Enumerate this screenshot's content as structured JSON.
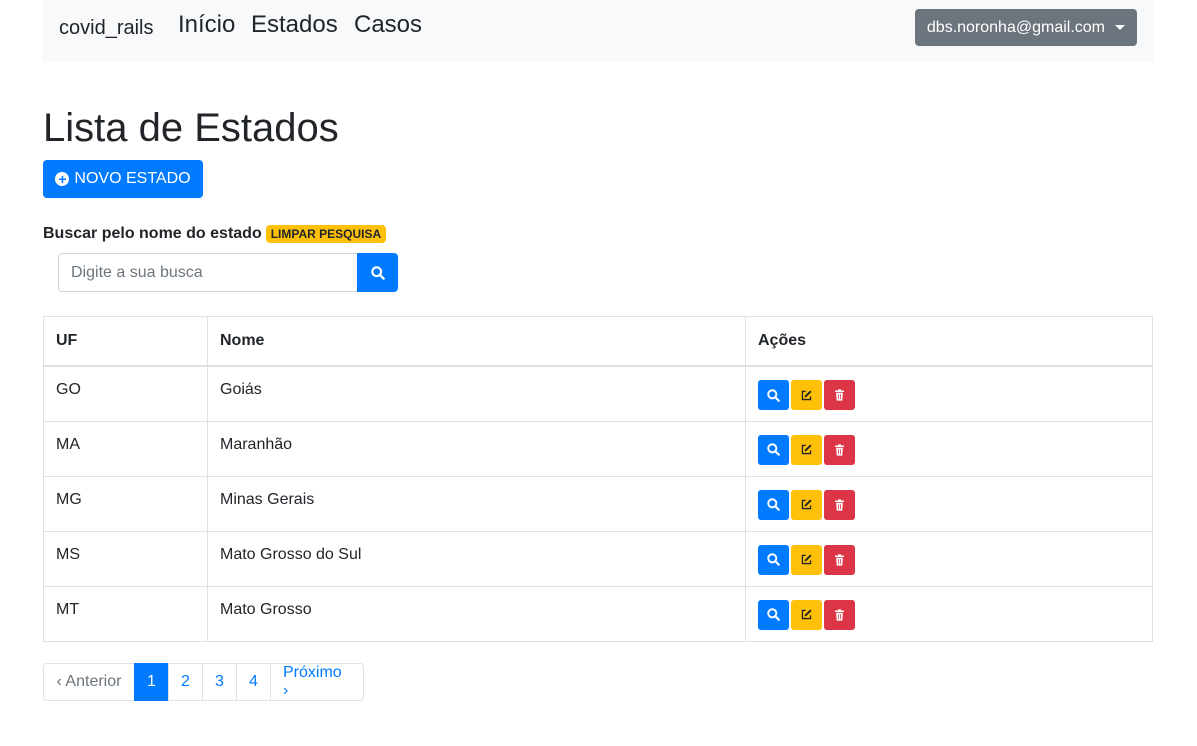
{
  "navbar": {
    "brand": "covid_rails",
    "links": [
      "Início",
      "Estados",
      "Casos"
    ],
    "user_email": "dbs.noronha@gmail.com"
  },
  "page_title": "Lista de Estados",
  "new_button_label": "NOVO ESTADO",
  "search": {
    "label": "Buscar pelo nome do estado",
    "clear_label": "LIMPAR PESQUISA",
    "placeholder": "Digite a sua busca"
  },
  "table": {
    "headers": [
      "UF",
      "Nome",
      "Ações"
    ],
    "rows": [
      {
        "uf": "GO",
        "nome": "Goiás"
      },
      {
        "uf": "MA",
        "nome": "Maranhão"
      },
      {
        "uf": "MG",
        "nome": "Minas Gerais"
      },
      {
        "uf": "MS",
        "nome": "Mato Grosso do Sul"
      },
      {
        "uf": "MT",
        "nome": "Mato Grosso"
      }
    ]
  },
  "pagination": {
    "prev": "‹ Anterior",
    "pages": [
      "1",
      "2",
      "3",
      "4"
    ],
    "next": "Próximo ›"
  },
  "icons": {
    "new": "plus-circle-icon",
    "search": "search-icon",
    "edit": "edit-icon",
    "delete": "trash-icon",
    "dropdown": "caret-down-icon"
  },
  "colors": {
    "primary": "#007bff",
    "warning": "#ffc107",
    "danger": "#dc3545",
    "secondary": "#6c757d",
    "navbar_bg": "#f8f9fa"
  }
}
